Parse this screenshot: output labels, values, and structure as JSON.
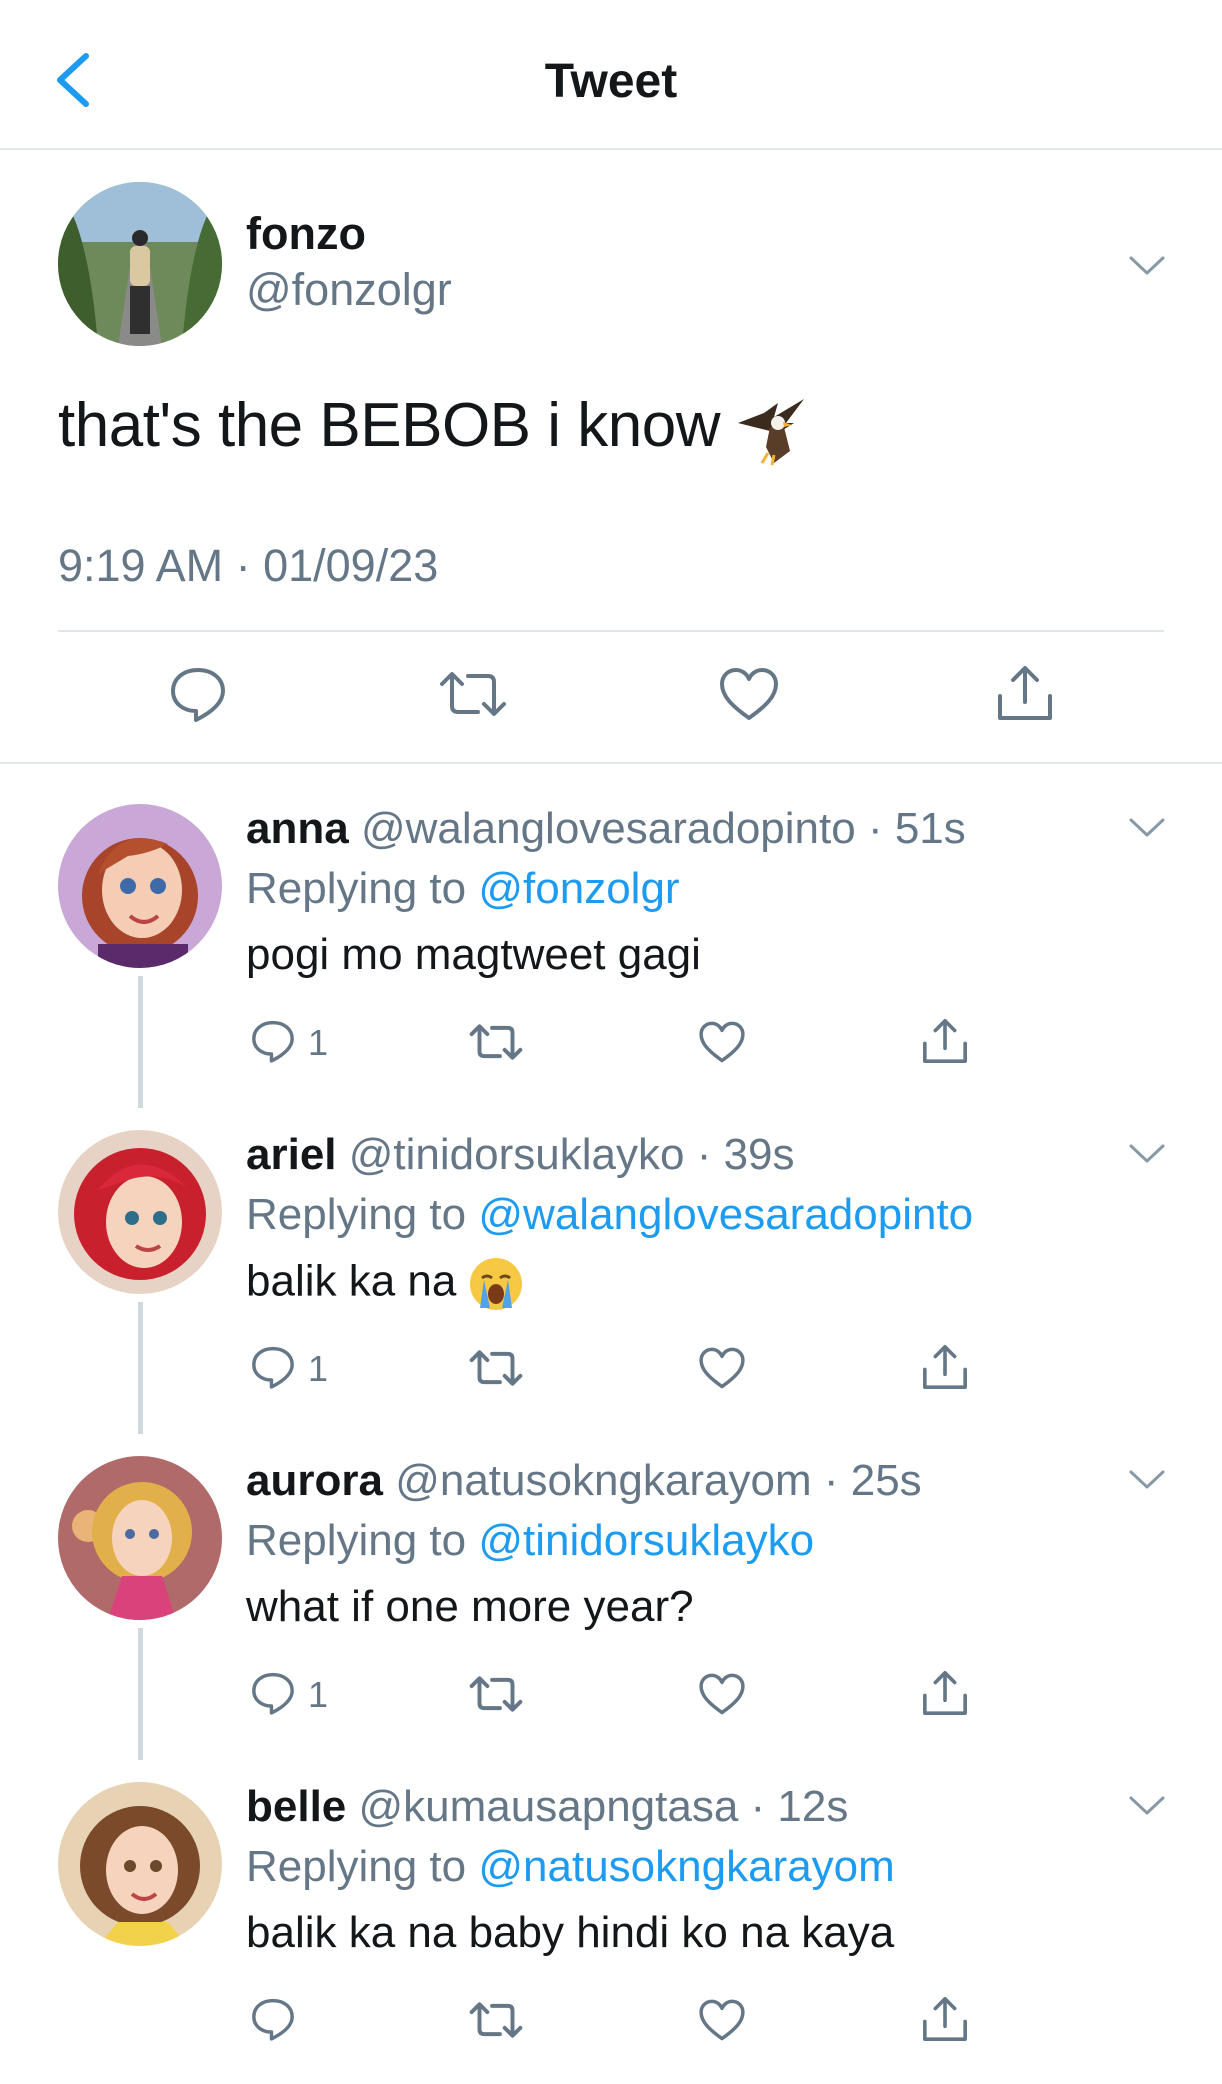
{
  "header": {
    "title": "Tweet"
  },
  "main_tweet": {
    "author": {
      "name": "fonzo",
      "handle": "@fonzolgr"
    },
    "text": "that's the BEBOB i know",
    "emoji": "eagle-emoji",
    "timestamp": "9:19 AM · 01/09/23"
  },
  "replies": [
    {
      "name": "anna",
      "handle": "@walanglovesaradopinto",
      "time": "· 51s",
      "replying_prefix": "Replying to",
      "replying_to": "@fonzolgr",
      "text": "pogi mo magtweet gagi",
      "reply_count": "1"
    },
    {
      "name": "ariel",
      "handle": "@tinidorsuklayko",
      "time": "· 39s",
      "replying_prefix": "Replying to",
      "replying_to": "@walanglovesaradopinto",
      "text": "balik ka na",
      "emoji": "loudly-crying-face-emoji",
      "reply_count": "1"
    },
    {
      "name": "aurora",
      "handle": "@natusokngkarayom",
      "time": "· 25s",
      "replying_prefix": "Replying to",
      "replying_to": "@tinidorsuklayko",
      "text": "what if one more year?",
      "reply_count": "1"
    },
    {
      "name": "belle",
      "handle": "@kumausapngtasa",
      "time": "· 12s",
      "replying_prefix": "Replying to",
      "replying_to": "@natusokngkarayom",
      "text": "balik ka na baby hindi ko na kaya",
      "reply_count": ""
    }
  ],
  "colors": {
    "accent": "#1d9bf0",
    "muted": "#657786",
    "divider": "#e1e6ea",
    "text": "#14171a"
  },
  "icons": [
    "back-arrow-icon",
    "caret-down-icon",
    "reply-icon",
    "retweet-icon",
    "like-icon",
    "share-icon"
  ]
}
